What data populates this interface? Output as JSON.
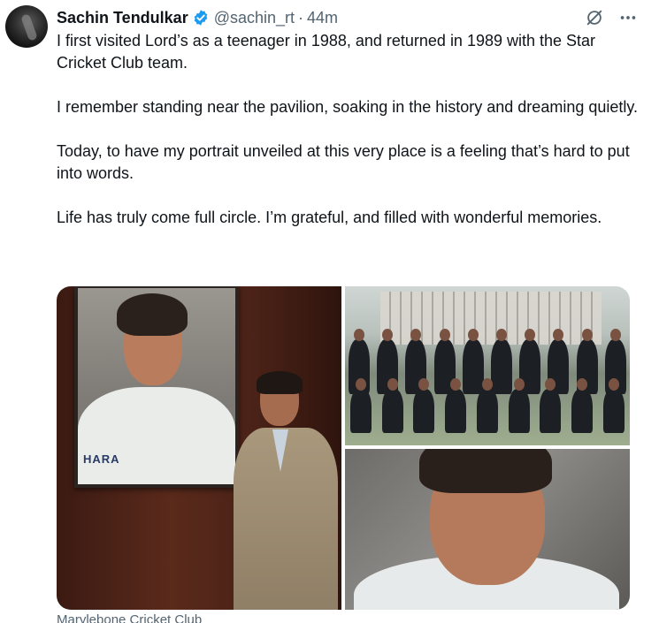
{
  "author": {
    "name": "Sachin Tendulkar",
    "handle": "@sachin_rt",
    "separator": "·",
    "time": "44m",
    "verified_color": "#1d9bf0"
  },
  "actions": {
    "grok_icon": "slash-circle-icon",
    "more_icon": "more-icon"
  },
  "tweet": {
    "paragraphs": [
      "I first visited Lord’s as a teenager in 1988, and returned in 1989 with the Star Cricket Club team.",
      "I remember standing near the pavilion, soaking in the history and dreaming quietly.",
      "Today, to have my portrait unveiled at this very place is a feeling that’s hard to put into words.",
      "Life has truly come full circle. I’m grateful, and filled with wonderful memories."
    ]
  },
  "media": {
    "portrait_shirt_text": "HARA",
    "caption": "Marylebone Cricket Club"
  }
}
